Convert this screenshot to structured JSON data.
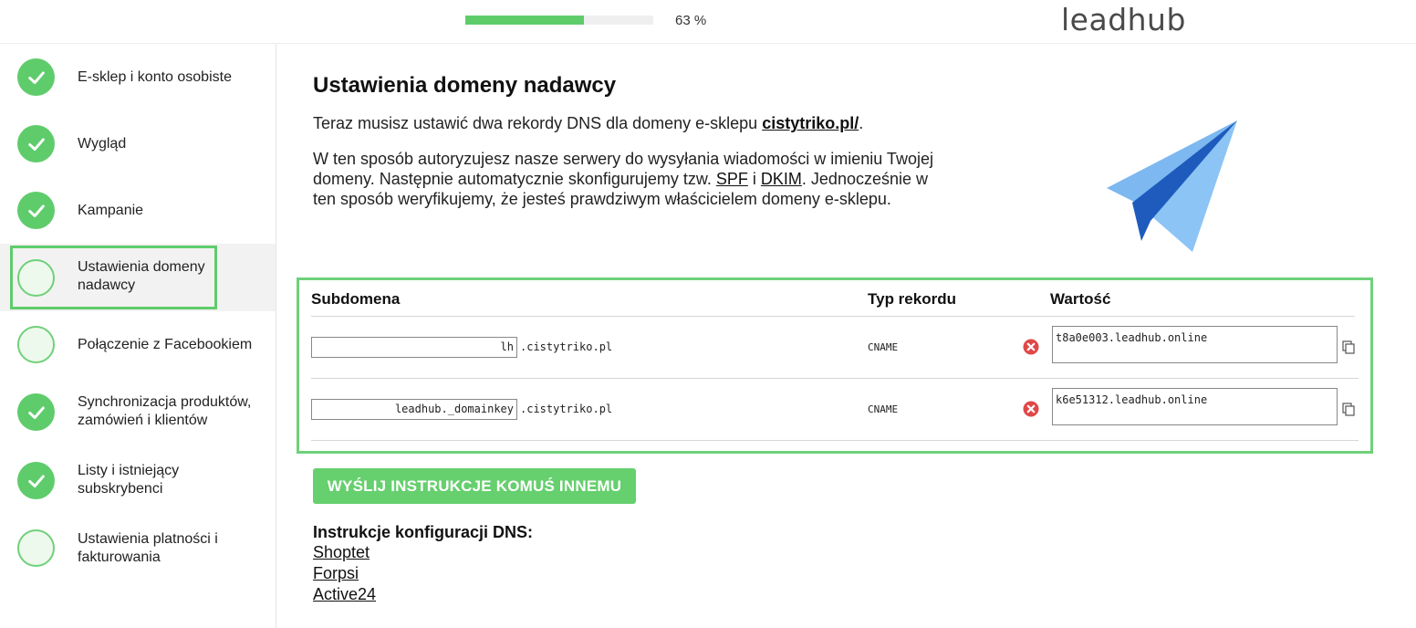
{
  "header": {
    "progress_fraction": 0.63,
    "progress_text": "63 %",
    "logo_text": "leadhub"
  },
  "sidebar": {
    "items": [
      {
        "label": "E-sklep i konto osobiste",
        "state": "done"
      },
      {
        "label": "Wygląd",
        "state": "done"
      },
      {
        "label": "Kampanie",
        "state": "done"
      },
      {
        "label": "Ustawienia domeny nadawcy",
        "state": "active"
      },
      {
        "label": "Połączenie z Facebookiem",
        "state": "todo"
      },
      {
        "label": "Synchronizacja produktów, zamówień i klientów",
        "state": "done"
      },
      {
        "label": "Listy i istniejący subskrybenci",
        "state": "done"
      },
      {
        "label": "Ustawienia platności i fakturowania",
        "state": "todo"
      }
    ]
  },
  "main": {
    "title": "Ustawienia domeny nadawcy",
    "intro_prefix": "Teraz musisz ustawić dwa rekordy DNS dla domeny e-sklepu ",
    "intro_domain": "cistytriko.pl/",
    "intro_suffix": ".",
    "desc_part1": "W ten sposób autoryzujesz nasze serwery do wysyłania wiadomości w imieniu Twojej domeny. Następnie automatycznie skonfigurujemy tzw. ",
    "desc_spf": "SPF",
    "desc_and": " i ",
    "desc_dkim": "DKIM",
    "desc_part2": ". Jednocześnie w ten sposób weryfikujemy, że jesteś prawdziwym właścicielem domeny e-sklepu."
  },
  "dns_table": {
    "headers": {
      "subdomain": "Subdomena",
      "type": "Typ rekordu",
      "value": "Wartość"
    },
    "domain_suffix": ".cistytriko.pl",
    "rows": [
      {
        "subdomain": "lh",
        "type": "CNAME",
        "value": "t8a0e003.leadhub.online"
      },
      {
        "subdomain": "leadhub._domainkey",
        "type": "CNAME",
        "value": "k6e51312.leadhub.online"
      }
    ]
  },
  "actions": {
    "send_button": "WYŚLIJ INSTRUKCJE KOMUŚ INNEMU"
  },
  "dns_guides": {
    "title": "Instrukcje konfiguracji DNS:",
    "links": [
      "Shoptet",
      "Forpsi",
      "Active24"
    ]
  },
  "colors": {
    "accent_green": "#5fcc6b",
    "error_red": "#e04848",
    "plane_light": "#7db8f0",
    "plane_dark": "#1e5bbd"
  }
}
